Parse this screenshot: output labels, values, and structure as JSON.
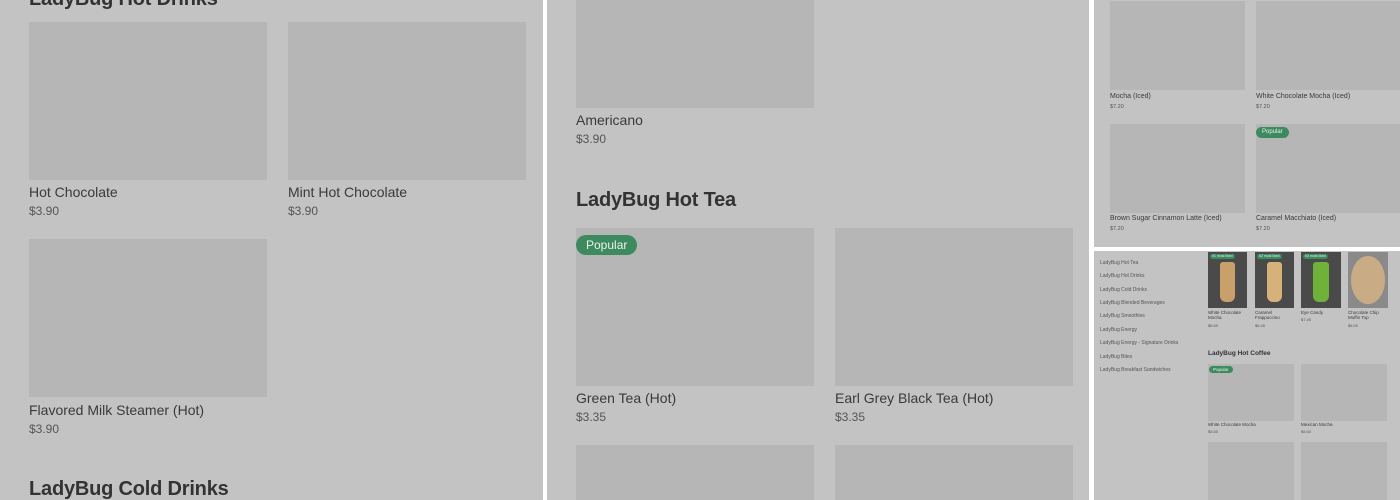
{
  "panel1": {
    "top_heading": "LadyBug Hot Drinks",
    "items": [
      {
        "name": "Hot Chocolate",
        "price": "$3.90"
      },
      {
        "name": "Mint Hot Chocolate",
        "price": "$3.90"
      },
      {
        "name": "Flavored Milk Steamer (Hot)",
        "price": "$3.90"
      }
    ],
    "bottom_heading": "LadyBug Cold Drinks"
  },
  "panel2": {
    "top_item": {
      "name": "Americano",
      "price": "$3.90"
    },
    "section_heading": "LadyBug Hot Tea",
    "popular_badge": "Popular",
    "items": [
      {
        "name": "Green Tea (Hot)",
        "price": "$3.35"
      },
      {
        "name": "Earl Grey Black Tea (Hot)",
        "price": "$3.35"
      }
    ]
  },
  "panel3": {
    "popular_badge": "Popular",
    "items": [
      {
        "name": "Mocha (Iced)",
        "price": "$7.20"
      },
      {
        "name": "White Chocolate Mocha (Iced)",
        "price": "$7.20"
      },
      {
        "name": "Brown Sugar Cinnamon Latte (Iced)",
        "price": "$7.20"
      },
      {
        "name": "Caramel Macchiato (Iced)",
        "price": "$7.20"
      }
    ]
  },
  "panel4": {
    "nav_items": [
      "LadyBug Hot Tea",
      "LadyBug Hot Drinks",
      "LadyBug Cold Drinks",
      "LadyBug Blended Beverages",
      "LadyBug Smoothies",
      "LadyBug Energy",
      "LadyBug Energy - Signature Drinks",
      "LadyBug Bites",
      "LadyBug Breakfast Sandwiches"
    ],
    "featured": [
      {
        "name": "White Chocolate Mocha",
        "price": "$6.60",
        "badge": "#1 most liked"
      },
      {
        "name": "Caramel Frappuccino",
        "price": "$6.45",
        "badge": "#2 most liked"
      },
      {
        "name": "Eye Candy",
        "price": "$7.45",
        "badge": "#3 most liked"
      },
      {
        "name": "Chocolate Chip Muffin Top",
        "price": "$5.00",
        "badge": ""
      }
    ],
    "section_heading": "LadyBug Hot Coffee",
    "popular_badge": "Popular",
    "items": [
      {
        "name": "White Chocolate Mocha",
        "price": "$5.60"
      },
      {
        "name": "Mexican Mocha",
        "price": "$5.60"
      }
    ],
    "colors": {
      "cup_1": "#c9a06a",
      "cup_2": "#d6b27a",
      "cup_3": "#6fb23a",
      "cookie": "#c9ab86"
    }
  }
}
